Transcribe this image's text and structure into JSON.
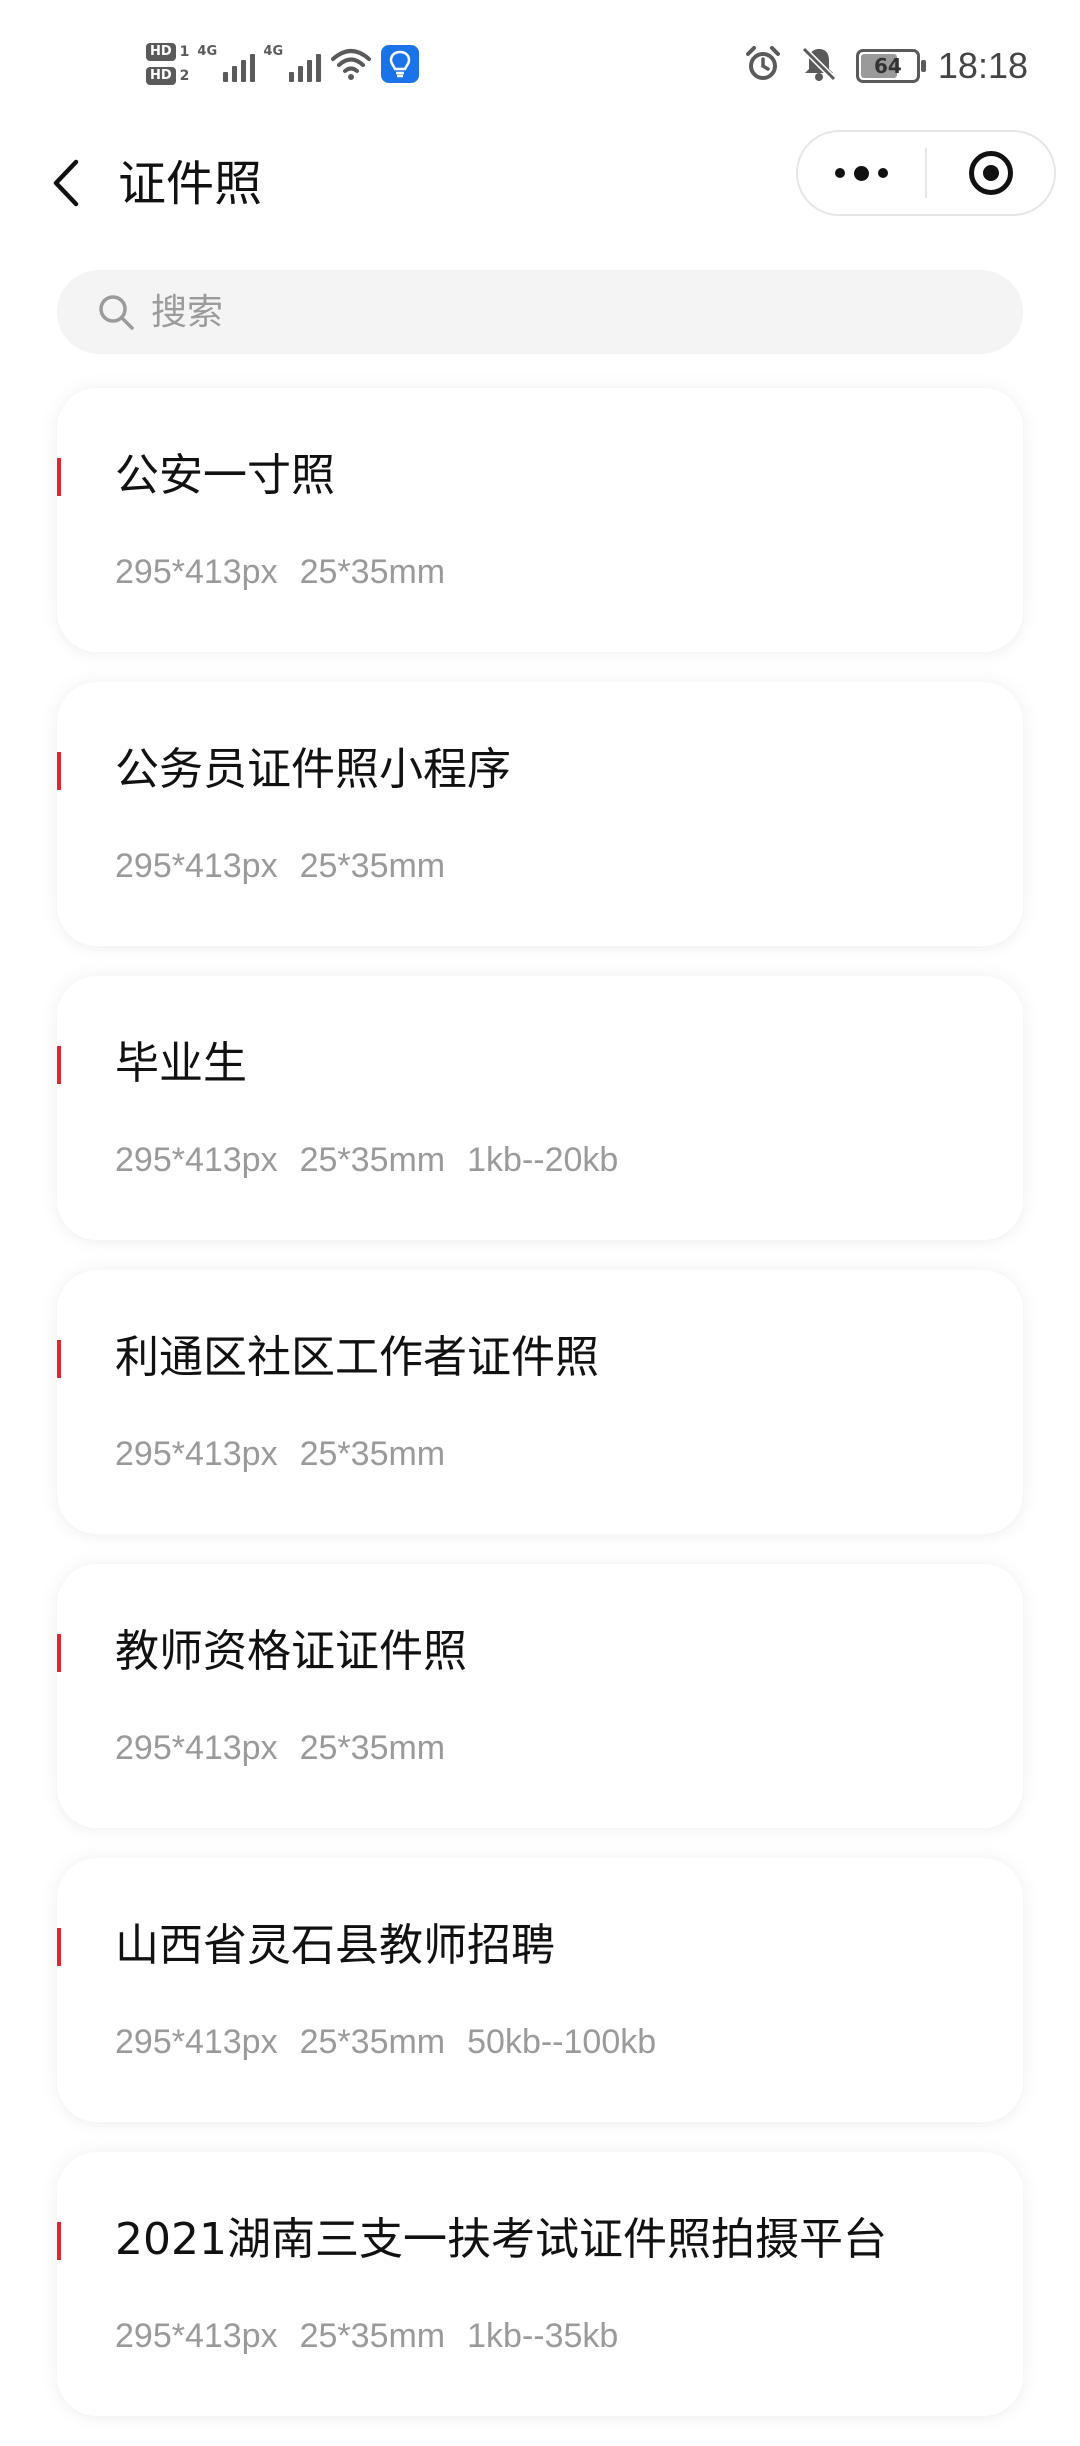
{
  "status_bar": {
    "hd_badges": [
      {
        "label": "HD",
        "num": "1"
      },
      {
        "label": "HD",
        "num": "2"
      }
    ],
    "signals": [
      {
        "tag": "4G"
      },
      {
        "tag": "4G"
      }
    ],
    "battery_level": "64",
    "time": "18:18",
    "icons": [
      "hd-icon",
      "signal-icon",
      "wifi-icon",
      "bulb-icon",
      "alarm-icon",
      "mute-icon",
      "battery-icon"
    ]
  },
  "header": {
    "title": "证件照"
  },
  "search": {
    "placeholder": "搜索",
    "value": ""
  },
  "items": [
    {
      "title": "公安一寸照",
      "specs": [
        "295*413px",
        "25*35mm"
      ]
    },
    {
      "title": "公务员证件照小程序",
      "specs": [
        "295*413px",
        "25*35mm"
      ]
    },
    {
      "title": "毕业生",
      "specs": [
        "295*413px",
        "25*35mm",
        "1kb--20kb"
      ]
    },
    {
      "title": "利通区社区工作者证件照",
      "specs": [
        "295*413px",
        "25*35mm"
      ]
    },
    {
      "title": "教师资格证证件照",
      "specs": [
        "295*413px",
        "25*35mm"
      ]
    },
    {
      "title": "山西省灵石县教师招聘",
      "specs": [
        "295*413px",
        "25*35mm",
        "50kb--100kb"
      ]
    },
    {
      "title": "2021湖南三支一扶考试证件照拍摄平台",
      "specs": [
        "295*413px",
        "25*35mm",
        "1kb--35kb"
      ]
    }
  ],
  "colors": {
    "accent": "#e0262e",
    "card_bg": "#ffffff",
    "search_bg": "#f4f4f4",
    "spec_text": "#9a9a9a",
    "title_text": "#111111"
  }
}
